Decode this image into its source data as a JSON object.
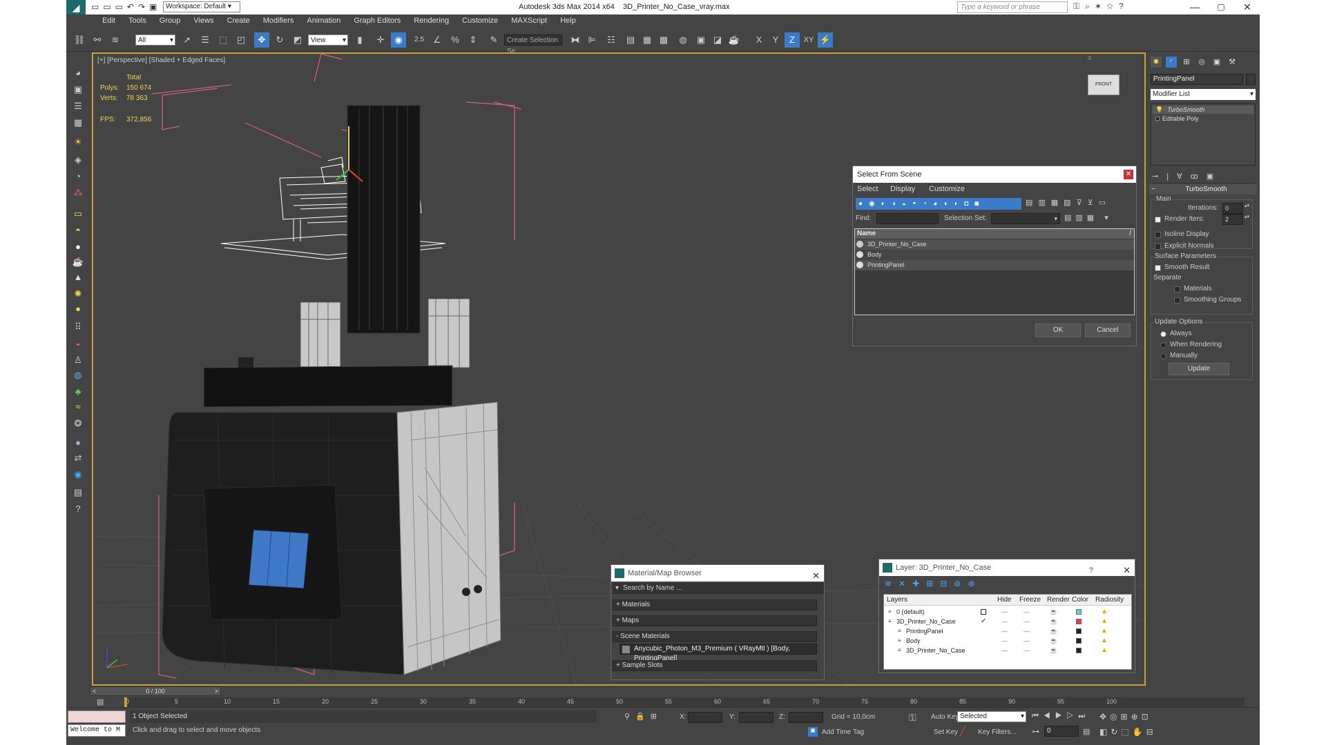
{
  "title_bar": {
    "workspace": "Workspace: Default",
    "app_title": "Autodesk 3ds Max  2014 x64",
    "file_name": "3D_Printer_No_Case_vray.max",
    "search_placeholder": "Type a keyword or phrase"
  },
  "menu": [
    "Edit",
    "Tools",
    "Group",
    "Views",
    "Create",
    "Modifiers",
    "Animation",
    "Graph Editors",
    "Rendering",
    "Customize",
    "MAXScript",
    "Help"
  ],
  "toolbar": {
    "filter_value": "All",
    "ref_coord_value": "View",
    "snap_angle": "2.5",
    "named_selection": "Create Selection Se",
    "axis_x": "X",
    "axis_y": "Y",
    "axis_z": "Z",
    "axis_xy": "XY"
  },
  "viewport": {
    "label": "[+] [Perspective] [Shaded + Edged Faces]",
    "stats_total": "Total",
    "polys_label": "Polys:",
    "polys_value": "150 674",
    "verts_label": "Verts:",
    "verts_value": "78 363",
    "fps_label": "FPS:",
    "fps_value": "372,856",
    "viewcube_label": "FRONT"
  },
  "select_from_scene": {
    "title": "Select From Scene",
    "menu": [
      "Select",
      "Display",
      "Customize"
    ],
    "find_label": "Find:",
    "selection_set_label": "Selection Set:",
    "column_name": "Name",
    "items": [
      "3D_Printer_No_Case",
      "Body",
      "PrintingPanel"
    ],
    "ok": "OK",
    "cancel": "Cancel"
  },
  "material_browser": {
    "title": "Material/Map Browser",
    "search_placeholder": "Search by Name ...",
    "sections": [
      "+ Materials",
      "+ Maps",
      "- Scene Materials"
    ],
    "scene_material": "Anycubic_Photon_M3_Premium  ( VRayMtl ) [Body, PrintingPanel]",
    "sample_slots": "+ Sample Slots"
  },
  "layer_dialog": {
    "title": "Layer: 3D_Printer_No_Case",
    "help": "?",
    "columns": [
      "Layers",
      "Hide",
      "Freeze",
      "Render",
      "Color",
      "Radiosity"
    ],
    "rows": [
      {
        "name": "0 (default)",
        "color": "#64d2c8"
      },
      {
        "name": "3D_Printer_No_Case",
        "color": "#e04040"
      },
      {
        "name": "PrintingPanel",
        "color": "#222222"
      },
      {
        "name": "Body",
        "color": "#222222"
      },
      {
        "name": "3D_Printer_No_Case",
        "color": "#222222"
      }
    ]
  },
  "command_panel": {
    "object_name": "PrintingPanel",
    "modifier_list": "Modifier List",
    "stack": [
      "TurboSmooth",
      "Editable Poly"
    ],
    "rollout_title": "TurboSmooth",
    "main": "Main",
    "iterations_label": "Iterations:",
    "iterations_value": "0",
    "render_iters_label": "Render Iters:",
    "render_iters_value": "2",
    "isoline": "Isoline Display",
    "explicit_normals": "Explicit Normals",
    "surface_params": "Surface Parameters",
    "smooth_result": "Smooth Result",
    "separate": "Separate",
    "materials": "Materials",
    "smoothing_groups": "Smoothing Groups",
    "update_options": "Update Options",
    "always": "Always",
    "when_rendering": "When Rendering",
    "manually": "Manually",
    "update_button": "Update"
  },
  "timeline": {
    "frame_label": "0 / 100",
    "ticks": [
      "0",
      "5",
      "10",
      "15",
      "20",
      "25",
      "30",
      "35",
      "40",
      "45",
      "50",
      "55",
      "60",
      "65",
      "70",
      "75",
      "80",
      "85",
      "90",
      "95",
      "100"
    ]
  },
  "status": {
    "script_prompt": "Welcome to M",
    "selected": "1 Object Selected",
    "hint": "Click and drag to select and move objects",
    "x_label": "X:",
    "y_label": "Y:",
    "z_label": "Z:",
    "grid": "Grid = 10,0cm",
    "add_time_tag": "Add Time Tag",
    "auto_key": "Auto Key",
    "set_key": "Set Key",
    "key_mode": "Selected",
    "key_filters": "Key Filters...",
    "frame_value": "0"
  }
}
